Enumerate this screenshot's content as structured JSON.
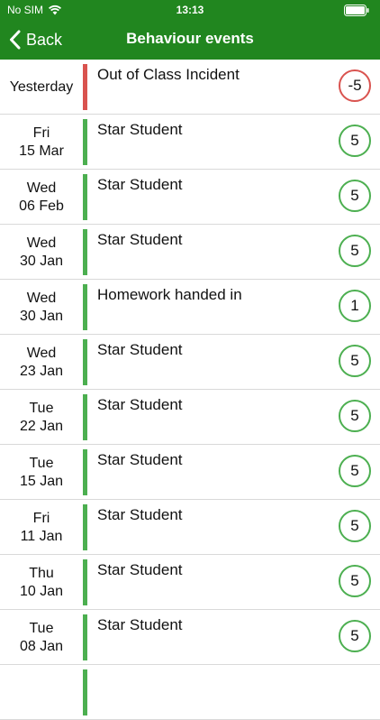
{
  "status_bar": {
    "carrier": "No SIM",
    "time": "13:13",
    "wifi_icon": "wifi-icon",
    "battery_icon": "battery-icon"
  },
  "nav": {
    "back_label": "Back",
    "back_icon": "chevron-left-icon",
    "title": "Behaviour events"
  },
  "colors": {
    "header": "#21861f",
    "positive": "#4caf50",
    "negative": "#d9534f"
  },
  "events": [
    {
      "day": "Yesterday",
      "date": "",
      "title": "Out of Class Incident",
      "points": "-5",
      "type": "negative"
    },
    {
      "day": "Fri",
      "date": "15 Mar",
      "title": "Star Student",
      "points": "5",
      "type": "positive"
    },
    {
      "day": "Wed",
      "date": "06 Feb",
      "title": "Star Student",
      "points": "5",
      "type": "positive"
    },
    {
      "day": "Wed",
      "date": "30 Jan",
      "title": "Star Student",
      "points": "5",
      "type": "positive"
    },
    {
      "day": "Wed",
      "date": "30 Jan",
      "title": "Homework handed in",
      "points": "1",
      "type": "positive"
    },
    {
      "day": "Wed",
      "date": "23 Jan",
      "title": "Star Student",
      "points": "5",
      "type": "positive"
    },
    {
      "day": "Tue",
      "date": "22 Jan",
      "title": "Star Student",
      "points": "5",
      "type": "positive"
    },
    {
      "day": "Tue",
      "date": "15 Jan",
      "title": "Star Student",
      "points": "5",
      "type": "positive"
    },
    {
      "day": "Fri",
      "date": "11 Jan",
      "title": "Star Student",
      "points": "5",
      "type": "positive"
    },
    {
      "day": "Thu",
      "date": "10 Jan",
      "title": "Star Student",
      "points": "5",
      "type": "positive"
    },
    {
      "day": "Tue",
      "date": "08 Jan",
      "title": "Star Student",
      "points": "5",
      "type": "positive"
    }
  ]
}
